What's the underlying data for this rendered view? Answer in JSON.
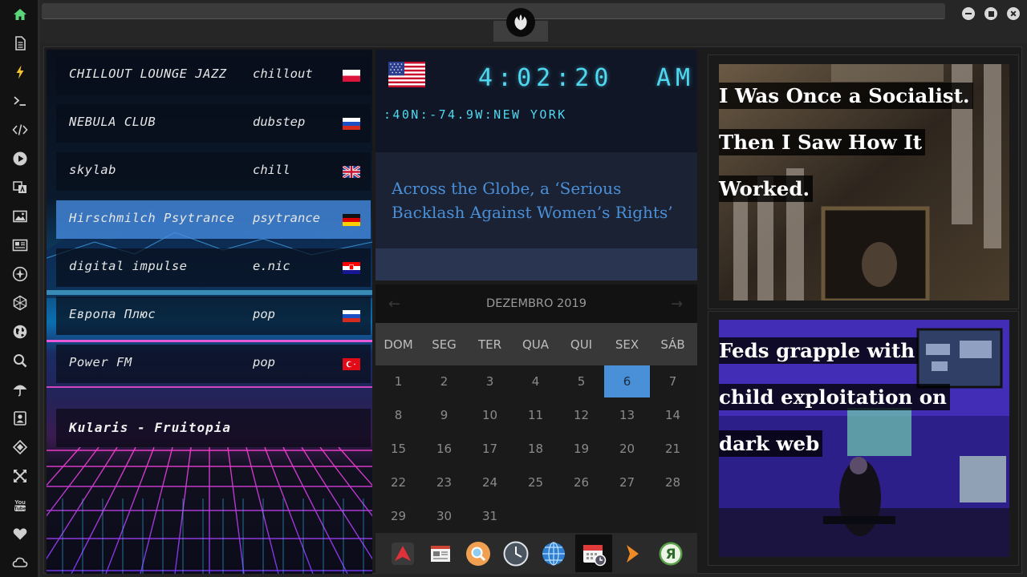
{
  "sidebar": {
    "icons": [
      "home-icon",
      "document-icon",
      "lightning-icon",
      "terminal-icon",
      "code-icon",
      "play-icon",
      "translate-icon",
      "image-icon",
      "news-icon",
      "rebel-icon",
      "hexagon-icon",
      "globe-icon",
      "search-icon",
      "umbrella-icon",
      "contact-icon",
      "tag-icon",
      "expand-icon",
      "youtube-icon",
      "heart-icon",
      "cloud-icon"
    ]
  },
  "radio": {
    "stations": [
      {
        "name": "CHILLOUT LOUNGE JAZZ",
        "genre": "chillout",
        "flag": "poland"
      },
      {
        "name": "NEBULA CLUB",
        "genre": "dubstep",
        "flag": "russia"
      },
      {
        "name": "skylab",
        "genre": "chill",
        "flag": "uk"
      },
      {
        "name": "Hirschmilch Psytrance",
        "genre": "psytrance",
        "flag": "germany"
      },
      {
        "name": "digital impulse",
        "genre": "e.nic",
        "flag": "croatia"
      },
      {
        "name": "Европа Плюс",
        "genre": "pop",
        "flag": "russia"
      },
      {
        "name": "Power FM",
        "genre": "pop",
        "flag": "turkey"
      }
    ],
    "active_index": 3,
    "now_playing": "Kularis - Fruitopia"
  },
  "clock": {
    "time": "4:02:20",
    "ampm": "AM",
    "location": ":40N:-74.9W:NEW YORK"
  },
  "news": {
    "headline": "Across the Globe, a ‘Serious Backlash Against Women’s Rights’"
  },
  "calendar": {
    "month": "DEZEMBRO 2019",
    "weekdays": [
      "DOM",
      "SEG",
      "TER",
      "QUA",
      "QUI",
      "SEX",
      "SÁB"
    ],
    "days": [
      "1",
      "2",
      "3",
      "4",
      "5",
      "6",
      "7",
      "8",
      "9",
      "10",
      "11",
      "12",
      "13",
      "14",
      "15",
      "16",
      "17",
      "18",
      "19",
      "20",
      "21",
      "22",
      "23",
      "24",
      "25",
      "26",
      "27",
      "28",
      "29",
      "30",
      "31"
    ],
    "today": "6",
    "prev": "←",
    "next": "→"
  },
  "dock": {
    "items": [
      "arrow-app-icon",
      "newspaper-app-icon",
      "search-app-icon",
      "clock-app-icon",
      "globe-app-icon",
      "calendar-app-icon",
      "play-app-icon",
      "yandex-app-icon"
    ]
  },
  "articles": [
    {
      "title_lines": [
        "I Was Once a Socialist.",
        "Then I Saw How It",
        "Worked."
      ]
    },
    {
      "title_lines": [
        "Feds grapple with",
        "child exploitation on",
        "dark web"
      ]
    }
  ],
  "colors": {
    "accent": "#4a90d9",
    "clock_cyan": "#4fd8f0",
    "sidebar_green": "#5cd67a"
  }
}
